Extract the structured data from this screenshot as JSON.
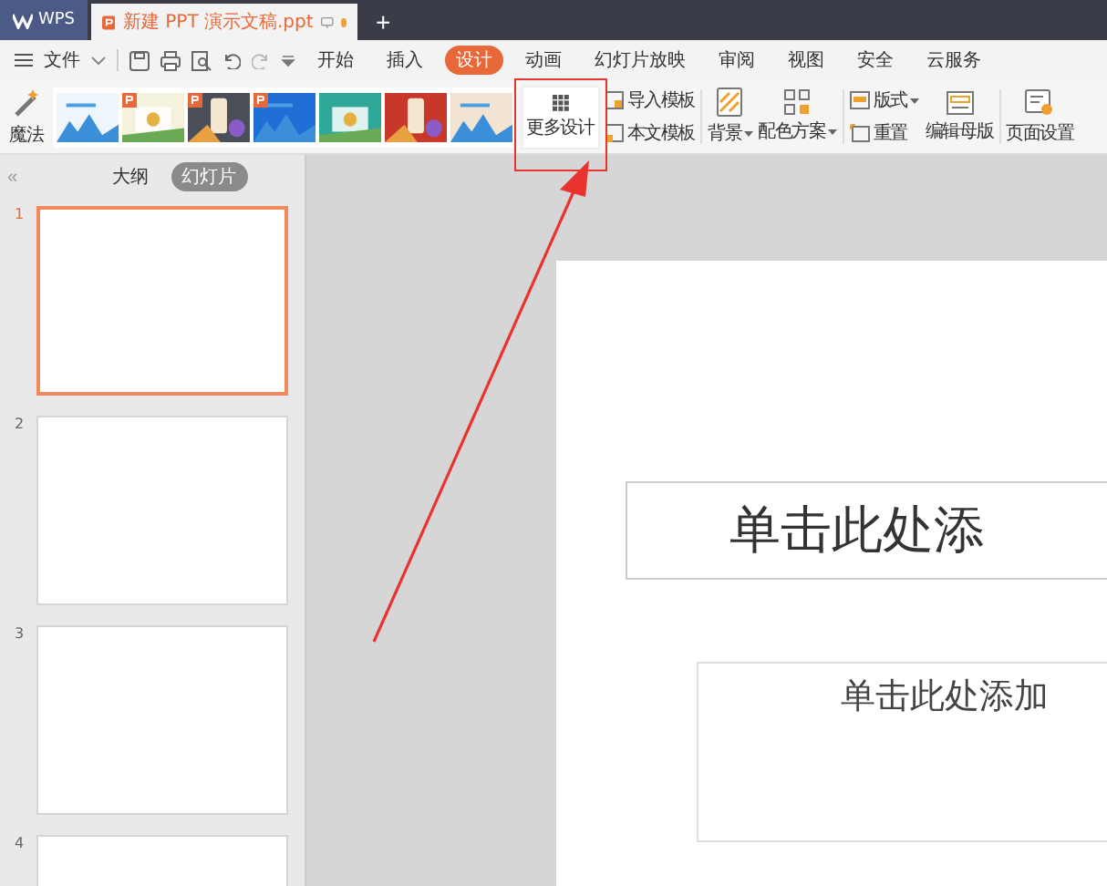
{
  "titlebar": {
    "app_tab": "WPS",
    "doc_tab": {
      "title": "新建 PPT 演示文稿.ppt",
      "modified": true
    },
    "new_tab": "+"
  },
  "menu": {
    "file": "文件",
    "tabs": [
      {
        "label": "开始",
        "selected": false
      },
      {
        "label": "插入",
        "selected": false
      },
      {
        "label": "设计",
        "selected": true
      },
      {
        "label": "动画",
        "selected": false
      },
      {
        "label": "幻灯片放映",
        "selected": false
      },
      {
        "label": "审阅",
        "selected": false
      },
      {
        "label": "视图",
        "selected": false
      },
      {
        "label": "安全",
        "selected": false
      },
      {
        "label": "云服务",
        "selected": false
      }
    ]
  },
  "ribbon": {
    "magic": "魔法",
    "templates": [
      {
        "kind": "picture",
        "badge": false,
        "color": "#eef5fb"
      },
      {
        "kind": "picture",
        "badge": true,
        "color": "#f4f1dc"
      },
      {
        "kind": "picture",
        "badge": true,
        "color": "#4a4f58"
      },
      {
        "kind": "picture",
        "badge": true,
        "color": "#1f6fd6"
      },
      {
        "kind": "picture",
        "badge": false,
        "color": "#2fa89a"
      },
      {
        "kind": "picture",
        "badge": false,
        "color": "#c8382a"
      },
      {
        "kind": "picture",
        "badge": false,
        "color": "#f1e4d2"
      }
    ],
    "more_design": "更多设计",
    "import_template": "导入模板",
    "doc_template": "本文模板",
    "background": "背景",
    "color_scheme": "配色方案",
    "layout": "版式",
    "reset": "重置",
    "edit_master": "编辑母版",
    "page_setup": "页面设置"
  },
  "panel": {
    "collapse": "«",
    "tabs": [
      {
        "label": "大纲",
        "selected": false
      },
      {
        "label": "幻灯片",
        "selected": true
      }
    ],
    "slides": [
      {
        "number": "1",
        "selected": true
      },
      {
        "number": "2",
        "selected": false
      },
      {
        "number": "3",
        "selected": false
      },
      {
        "number": "4",
        "selected": false
      }
    ]
  },
  "slide": {
    "title_placeholder": "单击此处添",
    "subtitle_placeholder": "单击此处添加"
  },
  "callout": {
    "kind": "arrow"
  }
}
